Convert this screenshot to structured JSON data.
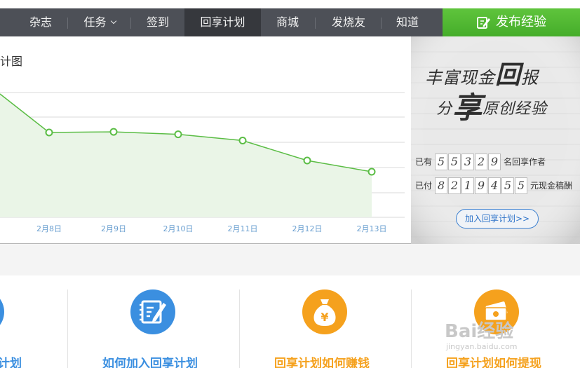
{
  "nav": {
    "items": [
      {
        "label": "杂志"
      },
      {
        "label": "任务"
      },
      {
        "label": "签到"
      },
      {
        "label": "回享计划"
      },
      {
        "label": "商城"
      },
      {
        "label": "发烧友"
      },
      {
        "label": "知道"
      }
    ],
    "active_index": 3,
    "publish_label": "发布经验"
  },
  "chart_title_fragment": "计图",
  "chart_data": {
    "type": "area",
    "categories": [
      "2月8日",
      "2月9日",
      "2月10日",
      "2月11日",
      "2月12日",
      "2月13日"
    ],
    "series": [
      {
        "values": [
          56,
          57,
          53,
          43,
          11,
          -7
        ]
      }
    ],
    "line_color": "#5bbd45",
    "fill_color": "#eaf5e7",
    "grid": true
  },
  "promo": {
    "slogan_line1_pre": "丰富现金",
    "slogan_line1_big": "回",
    "slogan_line1_post": "报",
    "slogan_line2_pre": "分",
    "slogan_line2_big": "享",
    "slogan_line2_post": "原创经验",
    "authors_pre": "已有",
    "authors_digits": [
      "5",
      "5",
      "3",
      "2",
      "9"
    ],
    "authors_post": "名回享作者",
    "paid_pre": "已付",
    "paid_digits": [
      "8",
      "2",
      "1",
      "9",
      "4",
      "5",
      "5"
    ],
    "paid_post": "元现金稿酬",
    "join_label": "加入回享计划>>"
  },
  "tiles": [
    {
      "label": "计划",
      "color": "#3b8fe0"
    },
    {
      "label": "如何加入回享计划",
      "color": "#3b8fe0"
    },
    {
      "label": "回享计划如何赚钱",
      "color": "#f5a11d"
    },
    {
      "label": "回享计划如何提现",
      "color": "#f5a11d"
    }
  ],
  "watermark": {
    "brand": "Bai经验",
    "url": "jingyan.baidu.com"
  }
}
